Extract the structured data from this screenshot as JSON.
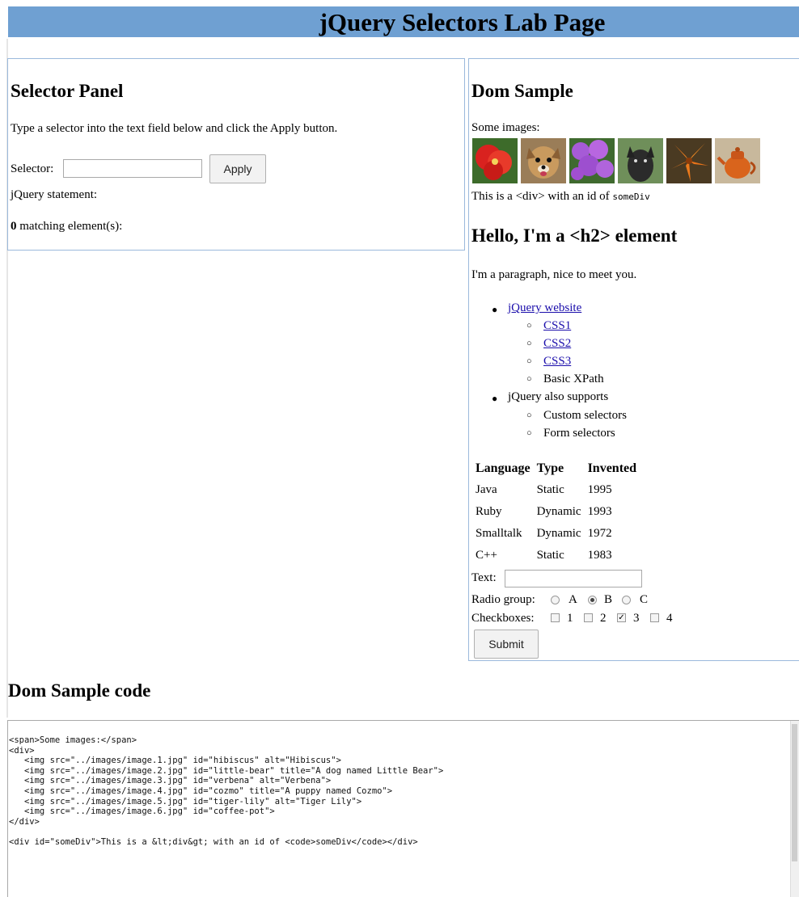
{
  "page": {
    "title": "jQuery Selectors Lab Page"
  },
  "selector_panel": {
    "heading": "Selector Panel",
    "instructions": "Type a selector into the text field below and click the Apply button.",
    "selector_label": "Selector:",
    "selector_value": "",
    "apply_label": "Apply",
    "statement_label": "jQuery statement:",
    "match_count": "0",
    "match_text": " matching element(s):"
  },
  "dom_sample": {
    "heading": "Dom Sample",
    "images_label": "Some images:",
    "images": [
      {
        "icon": "hibiscus-image"
      },
      {
        "icon": "little-bear-image"
      },
      {
        "icon": "verbena-image"
      },
      {
        "icon": "cozmo-image"
      },
      {
        "icon": "tiger-lily-image"
      },
      {
        "icon": "coffee-pot-image"
      }
    ],
    "div_text_prefix": "This is a <div> with an id of ",
    "div_code": "someDiv",
    "h2": "Hello, I'm a <h2> element",
    "paragraph": "I'm a paragraph, nice to meet you.",
    "list": {
      "item1": "jQuery website",
      "item1_sub": [
        "CSS1",
        "CSS2",
        "CSS3",
        "Basic XPath"
      ],
      "item2": "jQuery also supports",
      "item2_sub": [
        "Custom selectors",
        "Form selectors"
      ]
    },
    "table": {
      "headers": [
        "Language",
        "Type",
        "Invented"
      ],
      "rows": [
        [
          "Java",
          "Static",
          "1995"
        ],
        [
          "Ruby",
          "Dynamic",
          "1993"
        ],
        [
          "Smalltalk",
          "Dynamic",
          "1972"
        ],
        [
          "C++",
          "Static",
          "1983"
        ]
      ]
    },
    "text_label": "Text:",
    "text_value": "",
    "radio_label": "Radio group:",
    "radios": [
      "A",
      "B",
      "C"
    ],
    "radio_selected": "B",
    "checkbox_label": "Checkboxes:",
    "checkboxes": [
      "1",
      "2",
      "3",
      "4"
    ],
    "checkbox_checked": [
      "3"
    ],
    "submit_label": "Submit"
  },
  "code": {
    "heading": "Dom Sample code",
    "source": "<span>Some images:</span>\n<div>\n   <img src=\"../images/image.1.jpg\" id=\"hibiscus\" alt=\"Hibiscus\">\n   <img src=\"../images/image.2.jpg\" id=\"little-bear\" title=\"A dog named Little Bear\">\n   <img src=\"../images/image.3.jpg\" id=\"verbena\" alt=\"Verbena\">\n   <img src=\"../images/image.4.jpg\" id=\"cozmo\" title=\"A puppy named Cozmo\">\n   <img src=\"../images/image.5.jpg\" id=\"tiger-lily\" alt=\"Tiger Lily\">\n   <img src=\"../images/image.6.jpg\" id=\"coffee-pot\">\n</div>\n\n<div id=\"someDiv\">This is a &lt;div&gt; with an id of <code>someDiv</code></div>"
  }
}
